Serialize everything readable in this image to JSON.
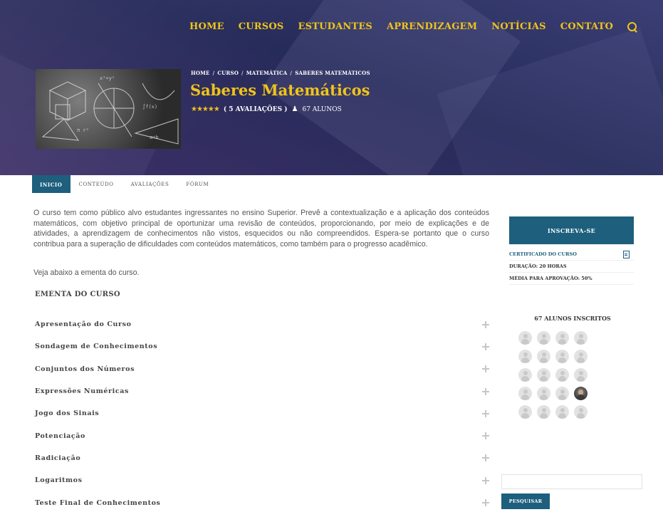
{
  "nav": {
    "items": [
      "HOME",
      "CURSOS",
      "ESTUDANTES",
      "APRENDIZAGEM",
      "NOTÍCIAS",
      "CONTATO"
    ],
    "search_icon": "search-icon"
  },
  "course": {
    "breadcrumb": [
      "HOME",
      "CURSO",
      "MATEMÁTICA",
      "SABERES MATEMÁTICOS"
    ],
    "title": "Saberes Matemáticos",
    "stars": "★★★★★",
    "reviews": "( 5 AVALIAÇÕES )",
    "students": "67 ALUNOS"
  },
  "tabs": [
    "INICIO",
    "CONTEÚDO",
    "AVALIAÇÕES",
    "FÓRUM"
  ],
  "main": {
    "description": "O curso tem como público alvo estudantes ingressantes no ensino Superior. Prevê a contextualização e a aplicação dos conteúdos matemáticos, com objetivo principal de oportunizar uma revisão de conteúdos, proporcionando, por meio de explicações e de atividades, a aprendizagem de conhecimentos não vistos, esquecidos ou não compreendidos. Espera-se portanto que o curso contribua para a superação de dificuldades com conteúdos matemáticos, como também para o progresso acadêmico.",
    "note": "Veja abaixo a ementa do curso.",
    "syllabus_title": "EMENTA DO CURSO",
    "syllabus": [
      "Apresentação do Curso",
      "Sondagem de Conhecimentos",
      "Conjuntos dos Números",
      "Expressões Numéricas",
      "Jogo dos Sinais",
      "Potenciação",
      "Radiciação",
      "Logaritmos",
      "Teste Final de Conhecimentos"
    ]
  },
  "sidebar": {
    "enroll": "INSCREVA-SE",
    "certificate": "CERTIFICADO DO CURSO",
    "duration": "DURAÇÃO: 20 HORAS",
    "approval": "MÉDIA PARA APROVAÇÃO: 50%",
    "students_title": "67 ALUNOS INSCRITOS",
    "search_placeholder": "",
    "search_button": "PESQUISAR"
  },
  "colors": {
    "accent": "#f0c419",
    "primary": "#1d5f7d",
    "hero": "#2b2f62"
  }
}
